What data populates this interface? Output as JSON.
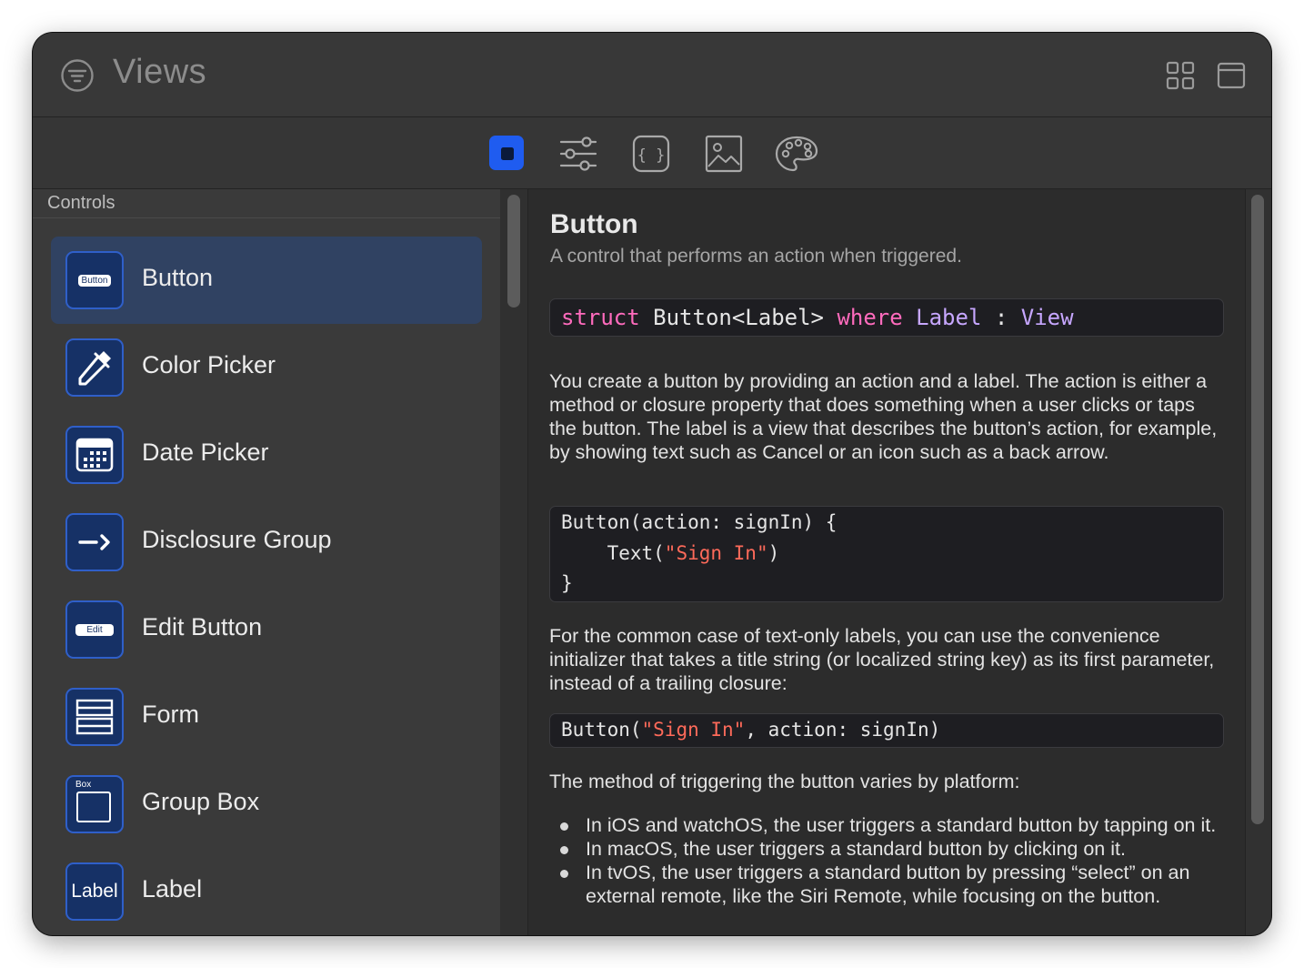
{
  "window": {
    "title": "Views"
  },
  "toolbar": {
    "tabs": [
      {
        "name": "library-views",
        "selected": true
      },
      {
        "name": "modifiers",
        "selected": false
      },
      {
        "name": "snippets",
        "selected": false
      },
      {
        "name": "media",
        "selected": false
      },
      {
        "name": "colors",
        "selected": false
      }
    ],
    "accent": "#1f5cf0"
  },
  "sidebar": {
    "section": "Controls",
    "items": [
      {
        "label": "Button",
        "icon": "button-glyph-icon",
        "icon_text": "Button",
        "selected": true
      },
      {
        "label": "Color Picker",
        "icon": "eyedropper-icon",
        "selected": false
      },
      {
        "label": "Date Picker",
        "icon": "calendar-icon",
        "selected": false
      },
      {
        "label": "Disclosure Group",
        "icon": "disclosure-icon",
        "selected": false
      },
      {
        "label": "Edit Button",
        "icon": "edit-button-glyph-icon",
        "icon_text": "Edit",
        "selected": false
      },
      {
        "label": "Form",
        "icon": "form-icon",
        "selected": false
      },
      {
        "label": "Group Box",
        "icon": "group-box-icon",
        "icon_text": "Box",
        "selected": false
      },
      {
        "label": "Label",
        "icon": "label-glyph-icon",
        "icon_text": "Label",
        "selected": false
      }
    ]
  },
  "detail": {
    "title": "Button",
    "subtitle": "A control that performs an action when triggered.",
    "declaration": {
      "kw1": "struct",
      "name": " Button<Label> ",
      "kw2": "where",
      "type1": " Label",
      "colon": " : ",
      "type2": "View"
    },
    "para1": "You create a button by providing an action and a label. The action is either a method or closure property that does something when a user clicks or taps the button. The label is a view that describes the button’s action, for example, by showing text such as Cancel or an icon such as a back arrow.",
    "code1": {
      "line1": "Button(action: signIn) {",
      "line2_pre": "    Text(",
      "line2_str": "\"Sign In\"",
      "line2_post": ")",
      "line3": "}"
    },
    "para2": "For the common case of text-only labels, you can use the convenience initializer that takes a title string (or localized string key) as its first parameter, instead of a trailing closure:",
    "code2": {
      "pre": "Button(",
      "str": "\"Sign In\"",
      "post": ", action: signIn)"
    },
    "para3": "The method of triggering the button varies by platform:",
    "bullets": [
      "In iOS and watchOS, the user triggers a standard button by tapping on it.",
      "In macOS, the user triggers a standard button by clicking on it.",
      "In tvOS, the user triggers a standard button by pressing “select” on an external remote, like the Siri Remote, while focusing on the button."
    ]
  }
}
